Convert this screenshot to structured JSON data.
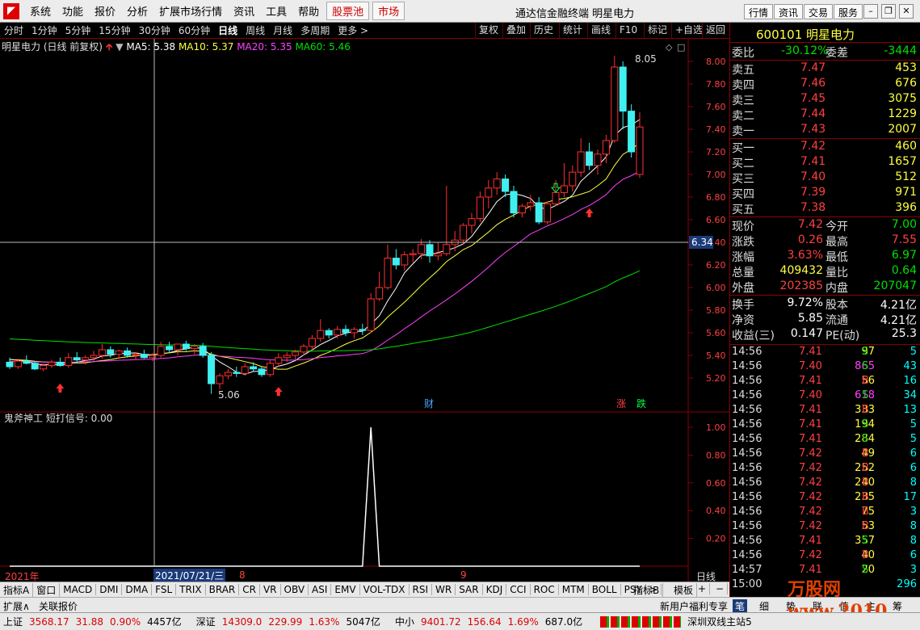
{
  "app": {
    "logo": "◤",
    "title": "通达信金融终端  明星电力"
  },
  "menu": {
    "items": [
      "系统",
      "功能",
      "报价",
      "分析",
      "扩展市场行情",
      "资讯",
      "工具",
      "帮助"
    ],
    "red_items": [
      "股票池",
      "市场"
    ],
    "right_buttons": [
      "行情",
      "资讯",
      "交易",
      "服务"
    ],
    "win": [
      "–",
      "❐",
      "✕"
    ]
  },
  "toolbar": {
    "periods": [
      "分时",
      "1分钟",
      "5分钟",
      "15分钟",
      "30分钟",
      "60分钟",
      "日线",
      "周线",
      "月线",
      "多周期",
      "更多 >"
    ],
    "active": "日线",
    "right": [
      "复权",
      "叠加",
      "历史",
      "统计",
      "画线",
      "F10",
      "标记",
      "+自选",
      "返回"
    ]
  },
  "chart": {
    "title": "明星电力 (日线 前复权)",
    "ma": [
      {
        "label": "MA5: 5.38",
        "color": "#ffffff"
      },
      {
        "label": "MA10: 5.37",
        "color": "#ffff40"
      },
      {
        "label": "MA20: 5.35",
        "color": "#ff40ff"
      },
      {
        "label": "MA60: 5.46",
        "color": "#00e000"
      }
    ],
    "yticks": [
      "8.00",
      "7.80",
      "7.60",
      "7.40",
      "7.20",
      "7.00",
      "6.80",
      "6.60",
      "6.40",
      "6.20",
      "6.00",
      "5.80",
      "5.60",
      "5.40",
      "5.20"
    ],
    "crosshair_value": "6.34",
    "high_label": "8.05",
    "low_label": "5.06",
    "marks": {
      "cai": "财",
      "zhang": "涨",
      "die": "跌"
    }
  },
  "indicator": {
    "title": "鬼斧神工  短打信号: 0.00",
    "yticks": [
      "1.00",
      "0.80",
      "0.60",
      "0.40",
      "0.20"
    ]
  },
  "xaxis": {
    "year": "2021年",
    "cursor_date": "2021/07/21/三",
    "m8": "8",
    "m9": "9",
    "daily": "日线"
  },
  "bottombar": {
    "tabs": [
      "指标A",
      "窗口",
      "MACD",
      "DMI",
      "DMA",
      "FSL",
      "TRIX",
      "BRAR",
      "CR",
      "VR",
      "OBV",
      "ASI",
      "EMV",
      "VOL-TDX",
      "RSI",
      "WR",
      "SAR",
      "KDJ",
      "CCI",
      "ROC",
      "MTM",
      "BOLL",
      "PSY",
      ">"
    ],
    "right": [
      "指标B",
      "模板",
      "+",
      "−"
    ]
  },
  "bottombar2": {
    "left": [
      "扩展∧",
      "关联报价"
    ],
    "right": "新用户福利专享"
  },
  "quote": {
    "code_name": "600101 明星电力",
    "weibi_label": "委比",
    "weibi": "-30.12%",
    "weicha_label": "委差",
    "weicha": "-3444",
    "sells": [
      {
        "label": "卖五",
        "price": "7.47",
        "vol": "453"
      },
      {
        "label": "卖四",
        "price": "7.46",
        "vol": "676"
      },
      {
        "label": "卖三",
        "price": "7.45",
        "vol": "3075"
      },
      {
        "label": "卖二",
        "price": "7.44",
        "vol": "1229"
      },
      {
        "label": "卖一",
        "price": "7.43",
        "vol": "2007"
      }
    ],
    "buys": [
      {
        "label": "买一",
        "price": "7.42",
        "vol": "460"
      },
      {
        "label": "买二",
        "price": "7.41",
        "vol": "1657"
      },
      {
        "label": "买三",
        "price": "7.40",
        "vol": "512"
      },
      {
        "label": "买四",
        "price": "7.39",
        "vol": "971"
      },
      {
        "label": "买五",
        "price": "7.38",
        "vol": "396"
      }
    ],
    "stats": [
      {
        "l1": "现价",
        "v1": "7.42",
        "c1": "red",
        "l2": "今开",
        "v2": "7.00",
        "c2": "green"
      },
      {
        "l1": "涨跌",
        "v1": "0.26",
        "c1": "red",
        "l2": "最高",
        "v2": "7.55",
        "c2": "red"
      },
      {
        "l1": "涨幅",
        "v1": "3.63%",
        "c1": "red",
        "l2": "最低",
        "v2": "6.97",
        "c2": "green"
      },
      {
        "l1": "总量",
        "v1": "409432",
        "c1": "yellow",
        "l2": "量比",
        "v2": "0.64",
        "c2": "green"
      },
      {
        "l1": "外盘",
        "v1": "202385",
        "c1": "red",
        "l2": "内盘",
        "v2": "207047",
        "c2": "green"
      }
    ],
    "stats2": [
      {
        "l1": "换手",
        "v1": "9.72%",
        "l2": "股本",
        "v2": "4.21亿"
      },
      {
        "l1": "净资",
        "v1": "5.85",
        "l2": "流通",
        "v2": "4.21亿"
      },
      {
        "l1": "收益(三)",
        "v1": "0.147",
        "l2": "PE(动)",
        "v2": "25.3"
      }
    ]
  },
  "ticks": [
    {
      "t": "14:56",
      "p": "7.41",
      "pc": "red",
      "v": "97",
      "vc": "yellow",
      "s": "S",
      "sc": "green",
      "n": "5"
    },
    {
      "t": "14:56",
      "p": "7.40",
      "pc": "red",
      "v": "865",
      "vc": "magenta",
      "s": "S",
      "sc": "green",
      "n": "43"
    },
    {
      "t": "14:56",
      "p": "7.41",
      "pc": "red",
      "v": "56",
      "vc": "yellow",
      "s": "B",
      "sc": "red",
      "n": "16"
    },
    {
      "t": "14:56",
      "p": "7.40",
      "pc": "red",
      "v": "618",
      "vc": "magenta",
      "s": "S",
      "sc": "green",
      "n": "34"
    },
    {
      "t": "14:56",
      "p": "7.41",
      "pc": "red",
      "v": "333",
      "vc": "yellow",
      "s": "B",
      "sc": "red",
      "n": "13"
    },
    {
      "t": "14:56",
      "p": "7.41",
      "pc": "red",
      "v": "194",
      "vc": "yellow",
      "s": "S",
      "sc": "green",
      "n": "5"
    },
    {
      "t": "14:56",
      "p": "7.41",
      "pc": "red",
      "v": "284",
      "vc": "yellow",
      "s": "S",
      "sc": "green",
      "n": "5"
    },
    {
      "t": "14:56",
      "p": "7.42",
      "pc": "red",
      "v": "49",
      "vc": "yellow",
      "s": "B",
      "sc": "red",
      "n": "6"
    },
    {
      "t": "14:56",
      "p": "7.42",
      "pc": "red",
      "v": "252",
      "vc": "yellow",
      "s": "B",
      "sc": "red",
      "n": "6"
    },
    {
      "t": "14:56",
      "p": "7.42",
      "pc": "red",
      "v": "240",
      "vc": "yellow",
      "s": "B",
      "sc": "red",
      "n": "8"
    },
    {
      "t": "14:56",
      "p": "7.42",
      "pc": "red",
      "v": "235",
      "vc": "yellow",
      "s": "B",
      "sc": "red",
      "n": "17"
    },
    {
      "t": "14:56",
      "p": "7.42",
      "pc": "red",
      "v": "75",
      "vc": "yellow",
      "s": "B",
      "sc": "red",
      "n": "3"
    },
    {
      "t": "14:56",
      "p": "7.42",
      "pc": "red",
      "v": "53",
      "vc": "yellow",
      "s": "B",
      "sc": "red",
      "n": "8"
    },
    {
      "t": "14:56",
      "p": "7.41",
      "pc": "red",
      "v": "357",
      "vc": "yellow",
      "s": "S",
      "sc": "green",
      "n": "8"
    },
    {
      "t": "14:56",
      "p": "7.42",
      "pc": "red",
      "v": "40",
      "vc": "yellow",
      "s": "B",
      "sc": "red",
      "n": "6"
    },
    {
      "t": "14:57",
      "p": "7.41",
      "pc": "red",
      "v": "20",
      "vc": "yellow",
      "s": "S",
      "sc": "green",
      "n": "3"
    },
    {
      "t": "15:00",
      "p": "",
      "pc": "red",
      "v": "",
      "vc": "yellow",
      "s": "",
      "sc": "red",
      "n": "296"
    }
  ],
  "right_tabs": [
    "笔",
    "细",
    "势",
    "联",
    "值",
    "主",
    "筹"
  ],
  "watermark": "万股网 www.2010",
  "status": {
    "items": [
      {
        "label": "上证",
        "v1": "3568.17",
        "v2": "31.88",
        "v3": "0.90%",
        "v4": "4457亿"
      },
      {
        "label": "深证",
        "v1": "14309.0",
        "v2": "229.99",
        "v3": "1.63%",
        "v4": "5047亿"
      },
      {
        "label": "中小",
        "v1": "9401.72",
        "v2": "156.64",
        "v3": "1.69%",
        "v4": "687.0亿"
      }
    ],
    "server": "深圳双线主站5"
  },
  "chart_data": {
    "type": "candlestick",
    "title": "明星电力 (日线 前复权)",
    "ylim": [
      5.0,
      8.1
    ],
    "candles": [
      [
        5.34,
        5.38,
        5.28,
        5.3
      ],
      [
        5.3,
        5.37,
        5.28,
        5.35
      ],
      [
        5.35,
        5.4,
        5.32,
        5.33
      ],
      [
        5.33,
        5.35,
        5.27,
        5.28
      ],
      [
        5.28,
        5.33,
        5.26,
        5.31
      ],
      [
        5.31,
        5.36,
        5.29,
        5.34
      ],
      [
        5.34,
        5.38,
        5.3,
        5.31
      ],
      [
        5.31,
        5.42,
        5.29,
        5.38
      ],
      [
        5.38,
        5.43,
        5.33,
        5.36
      ],
      [
        5.36,
        5.4,
        5.32,
        5.38
      ],
      [
        5.38,
        5.44,
        5.35,
        5.4
      ],
      [
        5.4,
        5.5,
        5.37,
        5.45
      ],
      [
        5.45,
        5.48,
        5.38,
        5.41
      ],
      [
        5.41,
        5.45,
        5.37,
        5.44
      ],
      [
        5.44,
        5.47,
        5.38,
        5.4
      ],
      [
        5.4,
        5.43,
        5.36,
        5.41
      ],
      [
        5.41,
        5.45,
        5.37,
        5.38
      ],
      [
        5.38,
        5.42,
        5.35,
        5.4
      ],
      [
        5.4,
        5.52,
        5.38,
        5.48
      ],
      [
        5.48,
        5.52,
        5.42,
        5.45
      ],
      [
        5.45,
        5.5,
        5.4,
        5.5
      ],
      [
        5.5,
        5.53,
        5.44,
        5.46
      ],
      [
        5.46,
        5.5,
        5.41,
        5.48
      ],
      [
        5.48,
        5.51,
        5.38,
        5.4
      ],
      [
        5.4,
        5.43,
        5.06,
        5.15
      ],
      [
        5.15,
        5.24,
        5.1,
        5.22
      ],
      [
        5.22,
        5.28,
        5.19,
        5.25
      ],
      [
        5.25,
        5.3,
        5.21,
        5.24
      ],
      [
        5.24,
        5.33,
        5.22,
        5.3
      ],
      [
        5.3,
        5.34,
        5.26,
        5.28
      ],
      [
        5.28,
        5.3,
        5.21,
        5.23
      ],
      [
        5.23,
        5.36,
        5.21,
        5.33
      ],
      [
        5.33,
        5.42,
        5.3,
        5.38
      ],
      [
        5.38,
        5.43,
        5.34,
        5.4
      ],
      [
        5.4,
        5.45,
        5.36,
        5.43
      ],
      [
        5.43,
        5.5,
        5.4,
        5.48
      ],
      [
        5.48,
        5.58,
        5.44,
        5.55
      ],
      [
        5.55,
        5.72,
        5.52,
        5.62
      ],
      [
        5.62,
        5.64,
        5.55,
        5.58
      ],
      [
        5.58,
        5.66,
        5.55,
        5.63
      ],
      [
        5.63,
        5.67,
        5.57,
        5.6
      ],
      [
        5.6,
        5.65,
        5.55,
        5.63
      ],
      [
        5.63,
        5.68,
        5.58,
        5.62
      ],
      [
        5.62,
        5.95,
        5.6,
        5.9
      ],
      [
        5.9,
        6.14,
        5.88,
        6.0
      ],
      [
        6.0,
        6.38,
        5.98,
        6.26
      ],
      [
        6.26,
        6.34,
        6.16,
        6.2
      ],
      [
        6.2,
        6.32,
        6.15,
        6.29
      ],
      [
        6.29,
        6.34,
        6.22,
        6.3
      ],
      [
        6.3,
        6.43,
        6.25,
        6.38
      ],
      [
        6.38,
        6.42,
        6.22,
        6.28
      ],
      [
        6.28,
        6.4,
        6.24,
        6.3
      ],
      [
        6.3,
        6.9,
        6.28,
        6.38
      ],
      [
        6.38,
        6.5,
        6.32,
        6.42
      ],
      [
        6.42,
        6.57,
        6.38,
        6.55
      ],
      [
        6.55,
        6.66,
        6.48,
        6.61
      ],
      [
        6.61,
        6.85,
        6.58,
        6.8
      ],
      [
        6.8,
        6.95,
        6.7,
        6.88
      ],
      [
        6.88,
        7.02,
        6.82,
        6.96
      ],
      [
        6.96,
        7.0,
        6.8,
        6.85
      ],
      [
        6.85,
        6.9,
        6.62,
        6.66
      ],
      [
        6.66,
        6.74,
        6.62,
        6.72
      ],
      [
        6.72,
        6.82,
        6.68,
        6.75
      ],
      [
        6.75,
        6.8,
        6.56,
        6.58
      ],
      [
        6.58,
        6.76,
        6.56,
        6.74
      ],
      [
        6.74,
        6.95,
        6.72,
        6.84
      ],
      [
        6.84,
        7.1,
        6.8,
        6.9
      ],
      [
        6.9,
        7.08,
        6.85,
        7.02
      ],
      [
        7.02,
        7.32,
        6.98,
        7.2
      ],
      [
        7.2,
        7.28,
        7.04,
        7.08
      ],
      [
        7.08,
        7.22,
        7.0,
        7.18
      ],
      [
        7.18,
        7.35,
        7.1,
        7.3
      ],
      [
        7.3,
        8.05,
        7.28,
        7.95
      ],
      [
        7.95,
        8.0,
        7.4,
        7.56
      ],
      [
        7.56,
        7.62,
        7.15,
        7.2
      ],
      [
        7.0,
        7.55,
        6.97,
        7.42
      ]
    ],
    "ma5_label": "MA5: 5.38",
    "ma10_label": "MA10: 5.37",
    "ma20_label": "MA20: 5.35",
    "ma60_label": "MA60: 5.46",
    "signal": {
      "name": "短打信号",
      "ylim": [
        0,
        1.1
      ],
      "spike_index": 43,
      "value": 1.0
    }
  }
}
